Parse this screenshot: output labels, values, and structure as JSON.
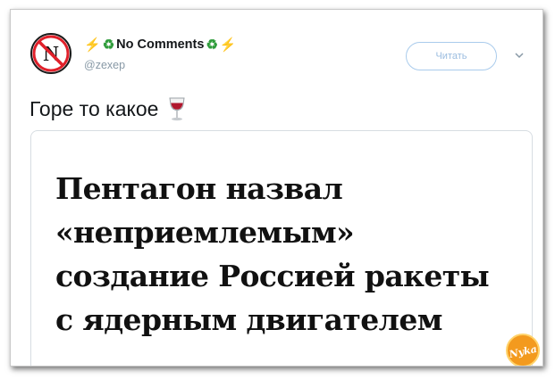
{
  "tweet": {
    "display_name": "No Comments",
    "handle": "@zexep",
    "follow_label": "Читать",
    "text": "Горе то какое",
    "emoji": "wine-glass-icon"
  },
  "card": {
    "headline_lines": [
      "Пентагон назвал",
      "«неприемлемым»",
      "создание Россией ракеты",
      "с ядерным двигателем"
    ]
  },
  "watermark": {
    "text": "Nyka"
  },
  "colors": {
    "follow_border": "#a9cbec",
    "follow_text": "#9bbde0",
    "handle": "#8899a6",
    "bolt": "#f5b800",
    "recycle": "#2e9c3a",
    "watermark_orange": "#f39a1e"
  }
}
